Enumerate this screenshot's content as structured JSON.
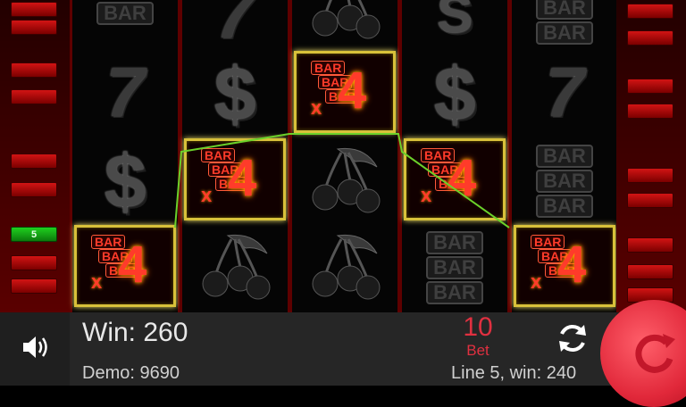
{
  "line_indicators": {
    "left": [
      "",
      "",
      "",
      "",
      "",
      "",
      "5",
      "",
      ""
    ],
    "right": [
      "",
      "",
      "",
      "",
      "",
      "",
      "",
      "",
      "",
      "",
      ""
    ]
  },
  "reels": [
    [
      "BAR",
      "7",
      "$",
      "BONUS"
    ],
    [
      "7",
      "$",
      "BONUS",
      "CHERRY"
    ],
    [
      "CHERRY",
      "BONUS",
      "CHERRY",
      "CHERRY"
    ],
    [
      "S",
      "$",
      "BONUS",
      "BAR"
    ],
    [
      "BAR",
      "7",
      "BAR",
      "BONUS"
    ]
  ],
  "bonus_symbol": {
    "word": "BAR",
    "multiplier_x": "x",
    "multiplier_n": "4"
  },
  "bar_symbol": {
    "word": "BAR"
  },
  "footer": {
    "win_label": "Win:",
    "win_value": "260",
    "demo_label": "Demo:",
    "demo_value": "9690",
    "bet_value": "10",
    "bet_label": "Bet",
    "line_info": "Line 5, win: 240"
  },
  "icons": {
    "sound": "speaker-icon",
    "refresh": "refresh-icon",
    "spin": "spin-icon"
  },
  "colors": {
    "accent_red": "#e03040",
    "win_frame": "#d8c13a",
    "line_active": "#1fd11f"
  }
}
